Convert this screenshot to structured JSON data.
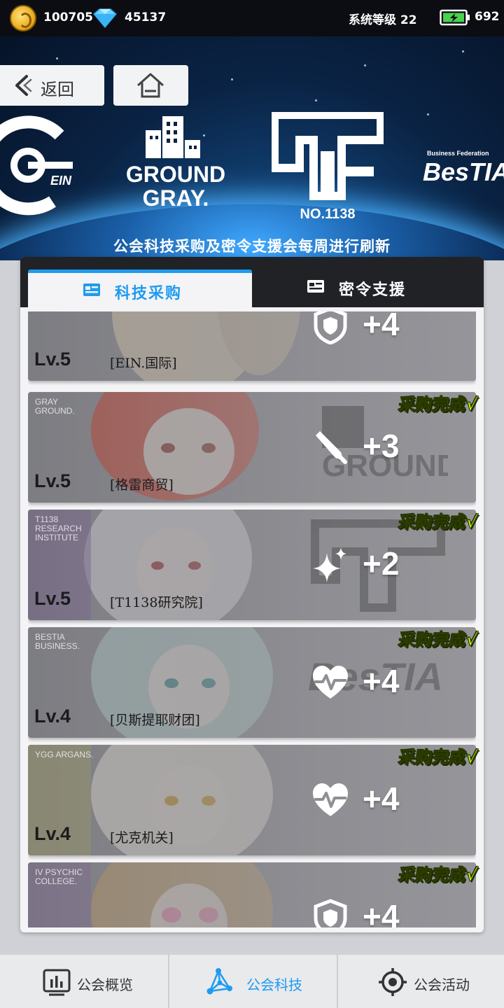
{
  "status": {
    "coins": "100705",
    "gems": "45137",
    "system_level": "系统等级 22",
    "energy": "692",
    "icons": [
      "coin-icon",
      "gem-icon",
      "battery-icon"
    ]
  },
  "header": {
    "back_label": "返回",
    "logos": {
      "ein": "EIN",
      "gg_line1": "GROUND",
      "gg_line2": "GRAY.",
      "t1138": "NO.1138",
      "bestia_small": "Business Federation",
      "bestia": "BesTIA"
    },
    "notice": "公会科技采购及密令支援会每周进行刷新"
  },
  "tabs": [
    {
      "label": "科技采购",
      "active": true
    },
    {
      "label": "密令支援",
      "active": false
    }
  ],
  "done_label": "采购完成√",
  "cards": [
    {
      "level": "Lv.5",
      "corp": "[EIN.国际]",
      "tag": "",
      "bonus": "+4",
      "stat_icon": "shield-icon",
      "done": false,
      "hair": "#e9d7b8"
    },
    {
      "level": "Lv.5",
      "corp": "[格雷商贸]",
      "tag": "GRAY GROUND.",
      "bonus": "+3",
      "stat_icon": "blade-icon",
      "done": true,
      "hair": "#d9402a"
    },
    {
      "level": "Lv.5",
      "corp": "[T1138研究院]",
      "tag": "T1138 RESEARCH INSTITUTE",
      "bonus": "+2",
      "stat_icon": "sparkle-icon",
      "done": true,
      "hair": "#e7e7ea"
    },
    {
      "level": "Lv.4",
      "corp": "[贝斯提耶财团]",
      "tag": "BESTIA BUSINESS.",
      "bonus": "+4",
      "stat_icon": "heartbeat-icon",
      "done": true,
      "hair": "#b9d8d2"
    },
    {
      "level": "Lv.4",
      "corp": "[尤克机关]",
      "tag": "YGG ARGANS.",
      "bonus": "+4",
      "stat_icon": "heartbeat-icon",
      "done": true,
      "hair": "#f1ecdf"
    },
    {
      "level": "",
      "corp": "",
      "tag": "IV PSYCHIC COLLEGE.",
      "bonus": "+4",
      "stat_icon": "shield-icon",
      "done": true,
      "hair": "#c9a46a"
    }
  ],
  "nav": [
    {
      "label": "公会概览",
      "icon": "chart-icon",
      "active": false
    },
    {
      "label": "公会科技",
      "icon": "network-icon",
      "active": true
    },
    {
      "label": "公会活动",
      "icon": "target-icon",
      "active": false
    }
  ]
}
